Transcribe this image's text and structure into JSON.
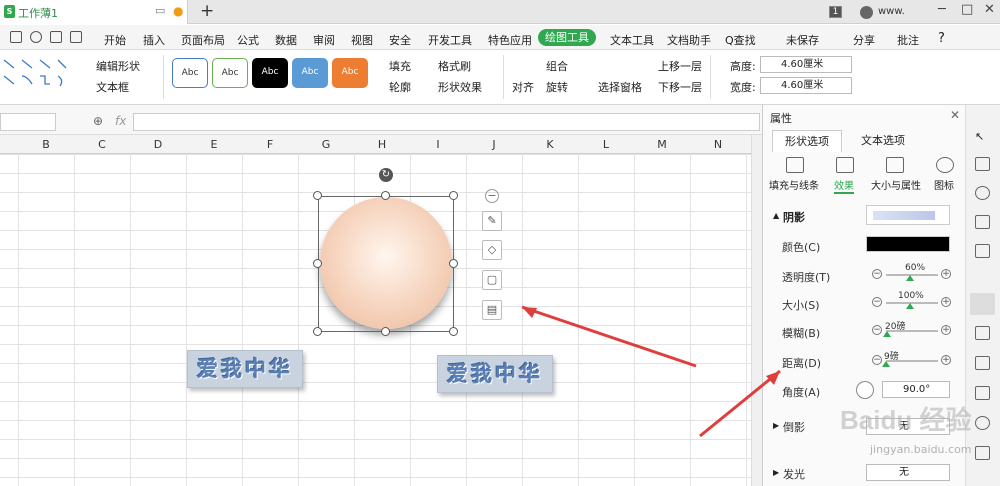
{
  "titlebar": {
    "doc_name": "工作薄1",
    "new_tab": "+",
    "page_badge": "1",
    "user": "www.",
    "win_min": "─",
    "win_max": "□",
    "win_close": "✕"
  },
  "menu": {
    "items": [
      "开始",
      "插入",
      "页面布局",
      "公式",
      "数据",
      "审阅",
      "视图",
      "安全",
      "开发工具",
      "特色应用"
    ],
    "active": "绘图工具",
    "after": [
      "文本工具",
      "文档助手"
    ],
    "search": "Q查找",
    "unsaved": "未保存",
    "share": "分享",
    "annotate": "批注",
    "help": "?"
  },
  "ribbon": {
    "edit_shape": "编辑形状",
    "text_box": "文本框",
    "styles": [
      "Abc",
      "Abc",
      "Abc",
      "Abc",
      "Abc"
    ],
    "fill": "填充",
    "format_painter": "格式刷",
    "outline": "轮廓",
    "shape_effect": "形状效果",
    "align": "对齐",
    "group": "组合",
    "rotate": "旋转",
    "select_pane": "选择窗格",
    "bring_forward": "上移一层",
    "send_backward": "下移一层",
    "height_label": "高度:",
    "height_value": "4.60厘米",
    "width_label": "宽度:",
    "width_value": "4.60厘米"
  },
  "formula": {
    "fx": "fx",
    "value": ""
  },
  "sheet": {
    "columns": [
      "B",
      "C",
      "D",
      "E",
      "F",
      "G",
      "H",
      "I",
      "J",
      "K",
      "L",
      "M",
      "N"
    ],
    "wordart_left": "爱我中华",
    "wordart_right": "爱我中华"
  },
  "panel": {
    "title": "属性",
    "tabs": [
      "形状选项",
      "文本选项"
    ],
    "subtabs": [
      "填充与线条",
      "效果",
      "大小与属性",
      "图标"
    ],
    "shadow": "阴影",
    "color": "颜色(C)",
    "transparency": "透明度(T)",
    "transparency_val": "60%",
    "size": "大小(S)",
    "size_val": "100%",
    "blur": "模糊(B)",
    "blur_val": "20磅",
    "distance": "距离(D)",
    "distance_val": "9磅",
    "angle": "角度(A)",
    "angle_val": "90.0°",
    "reflection": "倒影",
    "reflection_val": "无",
    "glow": "发光",
    "glow_val": "无"
  },
  "watermark": {
    "brand": "Baidu 经验",
    "url": "jingyan.baidu.com"
  },
  "colors": {
    "accent": "#2fa84f",
    "arrow": "#e03d3d",
    "wordart": "#5a7fb4"
  },
  "transparency": 0.6,
  "size_pct": 1.0,
  "blur_pt": 20,
  "distance_pt": 9
}
